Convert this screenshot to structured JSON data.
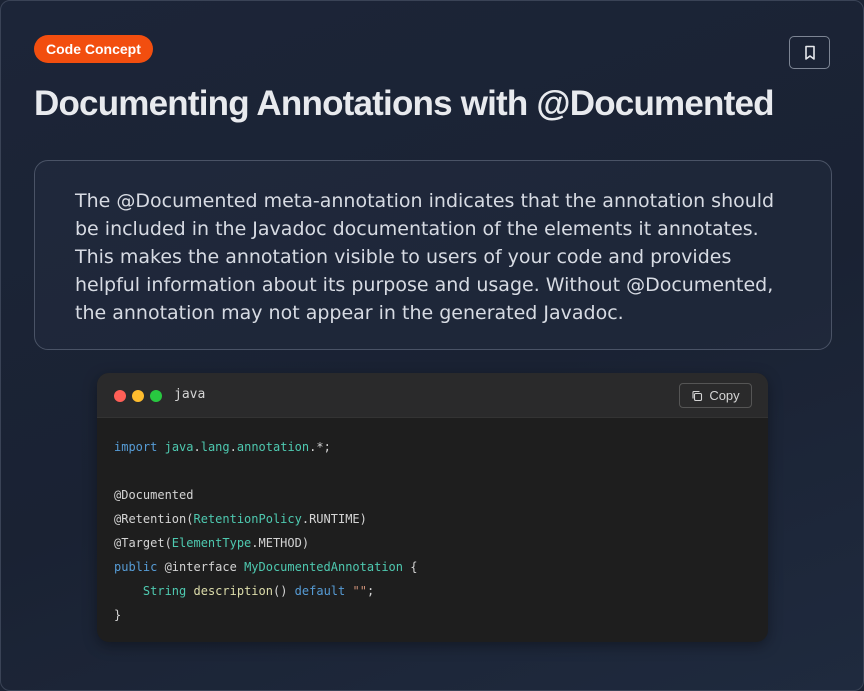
{
  "badge": {
    "label": "Code Concept",
    "color": "#f24e0f"
  },
  "header": {
    "title": "Documenting Annotations with @Documented",
    "bookmark_icon": "bookmark-icon"
  },
  "description": {
    "text": "The @Documented meta-annotation indicates that the annotation should be included in the Javadoc documentation of the elements it annotates. This makes the annotation visible to users of your code and provides helpful information about its purpose and usage. Without @Documented, the annotation may not appear in the generated Javadoc."
  },
  "code": {
    "language": "java",
    "copy_label": "Copy",
    "copy_icon": "copy-icon",
    "lines": [
      [
        {
          "t": "import",
          "c": "k"
        },
        {
          "t": " ",
          "c": "p"
        },
        {
          "t": "java",
          "c": "t"
        },
        {
          "t": ".",
          "c": "p"
        },
        {
          "t": "lang",
          "c": "t"
        },
        {
          "t": ".",
          "c": "p"
        },
        {
          "t": "annotation",
          "c": "t"
        },
        {
          "t": ".*;",
          "c": "p"
        }
      ],
      [],
      [
        {
          "t": "@Documented",
          "c": "p"
        }
      ],
      [
        {
          "t": "@Retention(",
          "c": "p"
        },
        {
          "t": "RetentionPolicy",
          "c": "t"
        },
        {
          "t": ".RUNTIME)",
          "c": "p"
        }
      ],
      [
        {
          "t": "@Target(",
          "c": "p"
        },
        {
          "t": "ElementType",
          "c": "t"
        },
        {
          "t": ".METHOD)",
          "c": "p"
        }
      ],
      [
        {
          "t": "public",
          "c": "k"
        },
        {
          "t": " @interface ",
          "c": "p"
        },
        {
          "t": "MyDocumentedAnnotation",
          "c": "t"
        },
        {
          "t": " {",
          "c": "p"
        }
      ],
      [
        {
          "t": "    ",
          "c": "p"
        },
        {
          "t": "String",
          "c": "t"
        },
        {
          "t": " ",
          "c": "p"
        },
        {
          "t": "description",
          "c": "f"
        },
        {
          "t": "() ",
          "c": "p"
        },
        {
          "t": "default",
          "c": "k"
        },
        {
          "t": " ",
          "c": "p"
        },
        {
          "t": "\"\"",
          "c": "s"
        },
        {
          "t": ";",
          "c": "p"
        }
      ],
      [
        {
          "t": "}",
          "c": "p"
        }
      ]
    ]
  }
}
